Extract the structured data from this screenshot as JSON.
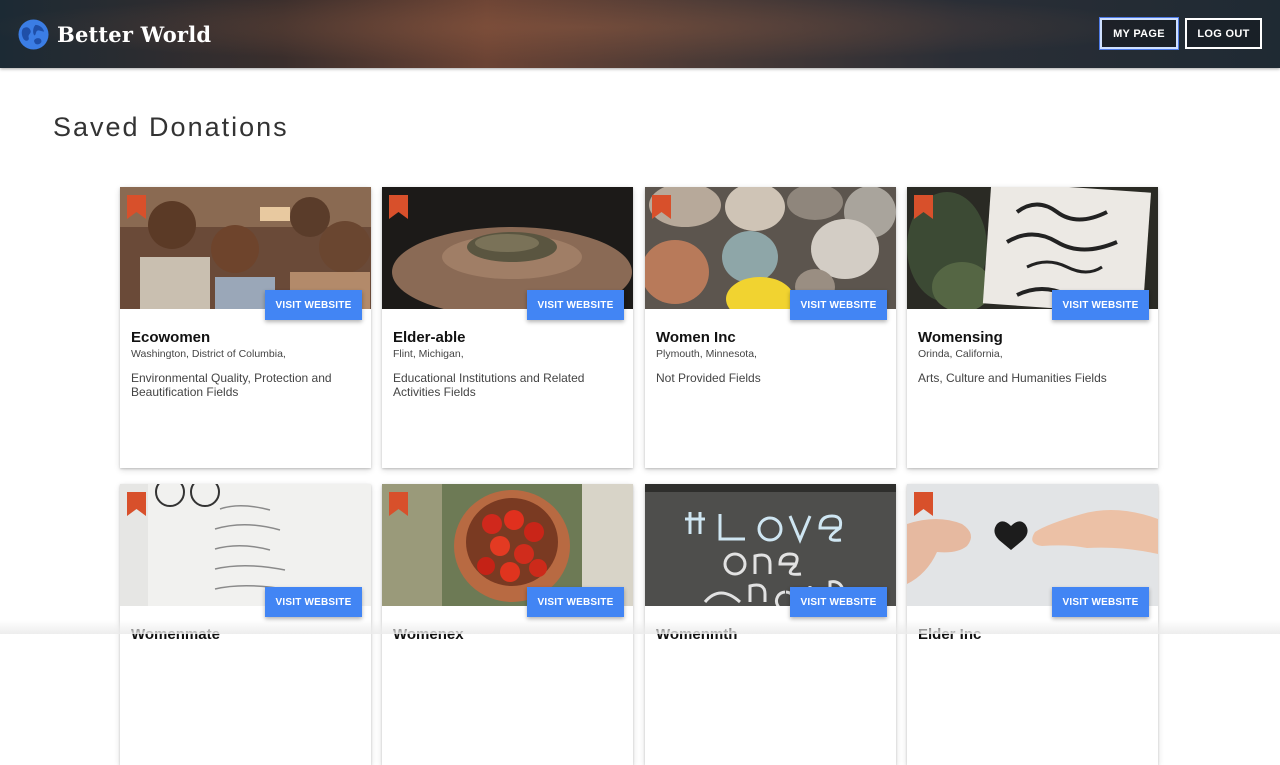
{
  "header": {
    "brand": "Better World",
    "my_page": "MY PAGE",
    "log_out": "LOG OUT"
  },
  "page_title": "Saved Donations",
  "visit_label": "VISIT WEBSITE",
  "colors": {
    "accent": "#4285f4",
    "bookmark": "#d8502b"
  },
  "cards": [
    {
      "title": "Ecowomen",
      "location": "Washington, District of Columbia,",
      "field": "Environmental Quality, Protection and Beautification Fields"
    },
    {
      "title": "Elder-able",
      "location": "Flint, Michigan,",
      "field": "Educational Institutions and Related Activities Fields"
    },
    {
      "title": "Women Inc",
      "location": "Plymouth, Minnesota,",
      "field": "Not Provided Fields"
    },
    {
      "title": "Womensing",
      "location": "Orinda, California,",
      "field": "Arts, Culture and Humanities Fields"
    },
    {
      "title": "Womenmate",
      "location": "",
      "field": ""
    },
    {
      "title": "Womenex",
      "location": "",
      "field": ""
    },
    {
      "title": "Womenmth",
      "location": "",
      "field": ""
    },
    {
      "title": "Elder Inc",
      "location": "",
      "field": ""
    }
  ]
}
